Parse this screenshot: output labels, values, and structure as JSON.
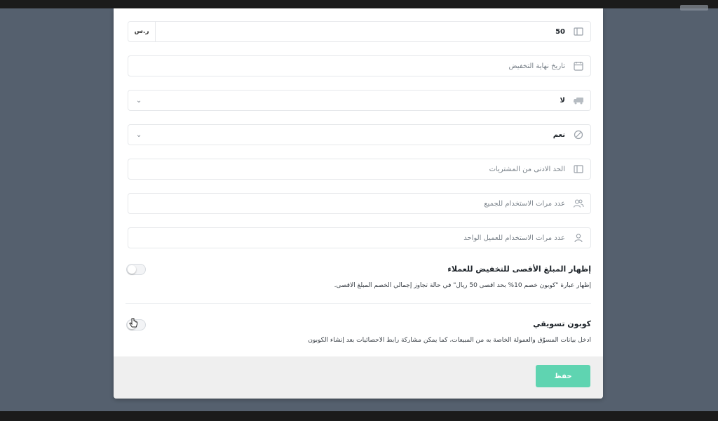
{
  "form": {
    "amount": {
      "value": "50",
      "suffix": "ر.س",
      "icon": "money-icon"
    },
    "end_date": {
      "placeholder": "تاريخ نهاية التخفيض",
      "icon": "calendar-icon"
    },
    "free_shipping": {
      "value": "لا",
      "icon": "truck-icon"
    },
    "exclude_discounted": {
      "value": "نعم",
      "icon": "circle-slash-icon"
    },
    "min_purchase": {
      "placeholder": "الحد الادنى من المشتريات",
      "icon": "money-icon"
    },
    "usage_total": {
      "placeholder": "عدد مرات الاستخدام للجميع",
      "icon": "users-icon"
    },
    "usage_per_customer": {
      "placeholder": "عدد مرات الاستخدام للعميل الواحد",
      "icon": "user-icon"
    }
  },
  "max_discount_section": {
    "title": "إظهار المبلغ الأقصى للتخفيض للعملاء",
    "description": "إظهار عبارة \"كوبون خصم 10% بحد اقصى 50 ريال\" في حالة تجاوز إجمالي الخصم المبلغ الاقصى."
  },
  "marketing_coupon_section": {
    "title": "كوبون تسويقي",
    "description": "ادخل بيانات المسوّق والعمولة الخاصة به من المبيعات، كما يمكن مشاركة رابط الاحصائيات بعد إنشاء الكوبون"
  },
  "footer": {
    "save_label": "حفظ"
  },
  "colors": {
    "accent": "#5fd4b1",
    "backdrop": "#55606e"
  }
}
